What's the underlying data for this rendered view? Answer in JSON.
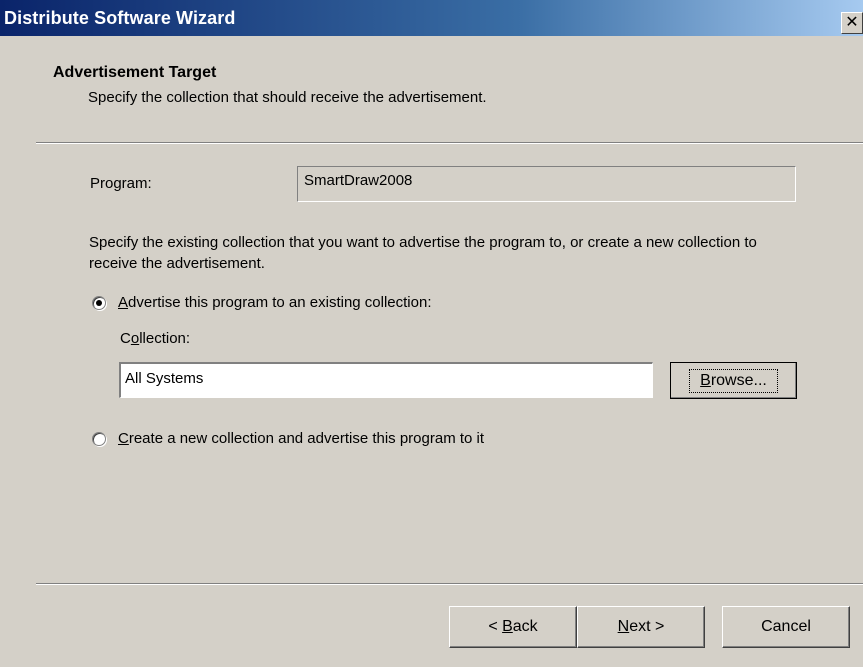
{
  "window": {
    "title": "Distribute Software Wizard",
    "close_glyph": "✕"
  },
  "header": {
    "title": "Advertisement Target",
    "subtitle": "Specify the collection that should receive the advertisement."
  },
  "program": {
    "label": "Program:",
    "value": "SmartDraw2008"
  },
  "description": "Specify the existing collection that you want to advertise the program to, or create a new collection to receive the advertisement.",
  "options": {
    "existing": {
      "label_rest": "dvertise this program to an existing collection:",
      "mnemonic": "A",
      "checked": true
    },
    "new": {
      "label_rest": "reate a new collection and advertise this program to it",
      "mnemonic": "C",
      "checked": false
    }
  },
  "collection": {
    "label_prefix": "C",
    "label_mnemonic": "o",
    "label_rest": "llection:",
    "value": "All Systems",
    "browse_label_prefix": "B",
    "browse_label_rest": "rowse..."
  },
  "buttons": {
    "back_prefix": "< ",
    "back_mnemonic": "B",
    "back_rest": "ack",
    "next_mnemonic": "N",
    "next_rest": "ext >",
    "cancel": "Cancel"
  }
}
